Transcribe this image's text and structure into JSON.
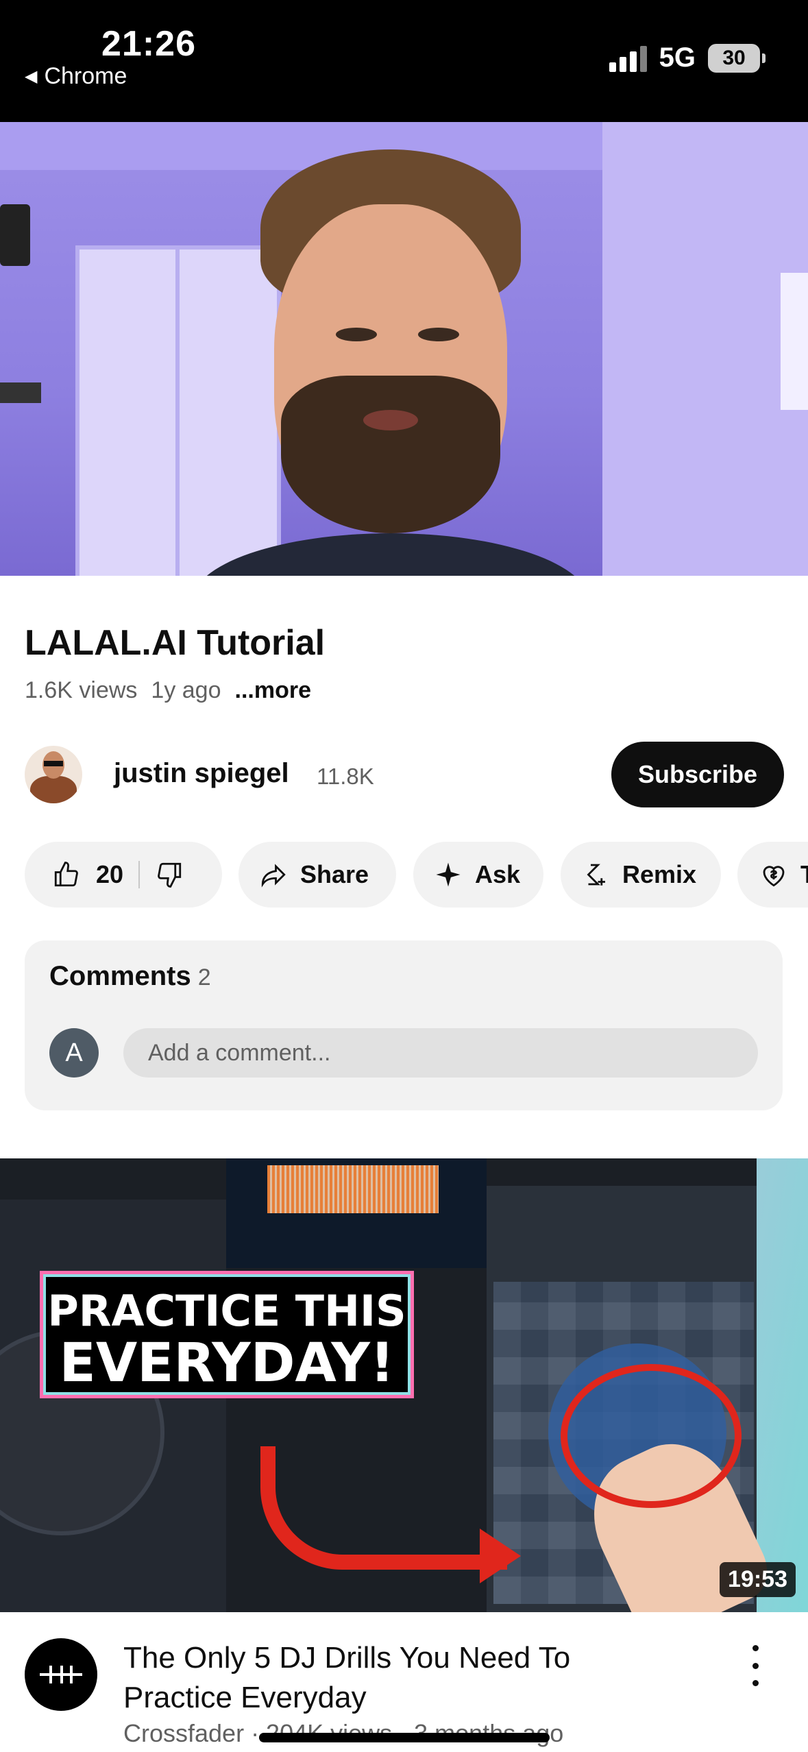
{
  "status_bar": {
    "time": "21:26",
    "back_app": "Chrome",
    "network": "5G",
    "battery": "30"
  },
  "video": {
    "title": "LALAL.AI Tutorial",
    "views": "1.6K views",
    "age": "1y ago",
    "more_label": "...more"
  },
  "channel": {
    "name": "justin spiegel",
    "subscribers": "11.8K",
    "subscribe_label": "Subscribe"
  },
  "actions": {
    "like_count": "20",
    "share_label": "Share",
    "ask_label": "Ask",
    "remix_label": "Remix",
    "thanks_label": "T"
  },
  "comments": {
    "title": "Comments",
    "count": "2",
    "user_initial": "A",
    "placeholder": "Add a comment..."
  },
  "next_video": {
    "thumbnail_line1": "PRACTICE THIS",
    "thumbnail_line2": "EVERYDAY!",
    "duration": "19:53",
    "title": "The Only 5 DJ Drills You Need To Practice Everyday",
    "meta": "Crossfader · 204K views · 3 months ago"
  },
  "colors": {
    "subscribe_bg": "#0f0f0f",
    "pill_bg": "#f2f2f2",
    "secondary_text": "#606060",
    "thumbnail_accent": "#e0261c"
  }
}
